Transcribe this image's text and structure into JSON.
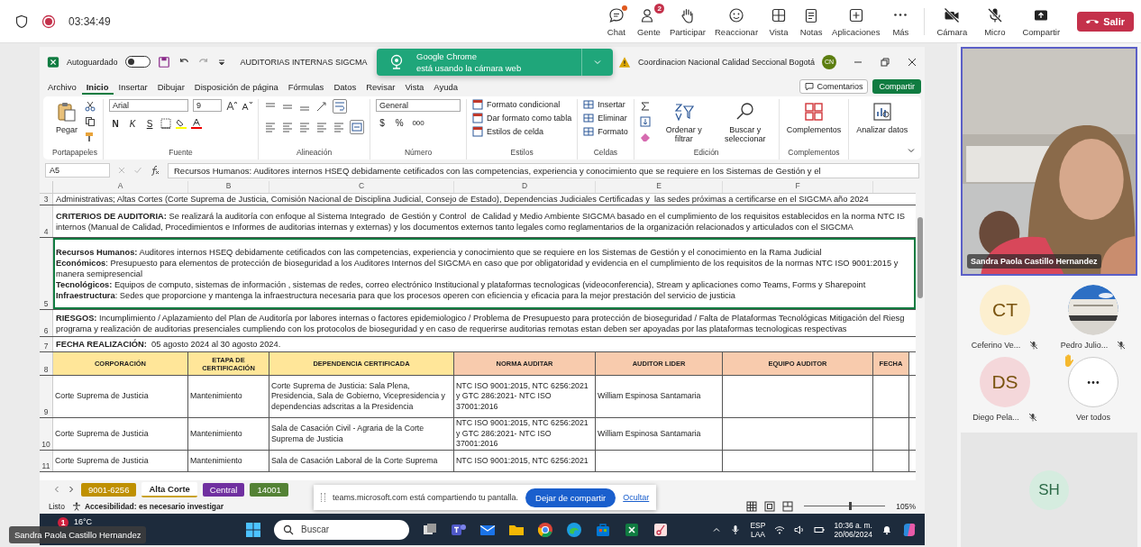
{
  "meeting_bar": {
    "timer": "03:34:49",
    "recording": true,
    "controls": [
      {
        "label": "Chat",
        "unread": true
      },
      {
        "label": "Gente",
        "unread": false,
        "badge": "2"
      },
      {
        "label": "Participar",
        "unread": false
      },
      {
        "label": "Reaccionar",
        "unread": false
      },
      {
        "label": "Vista",
        "unread": false
      },
      {
        "label": "Notas",
        "unread": false
      },
      {
        "label": "Aplicaciones",
        "unread": false
      },
      {
        "label": "Más",
        "unread": false
      }
    ],
    "media": [
      {
        "label": "Cámara",
        "on": false
      },
      {
        "label": "Micro",
        "on": false
      }
    ],
    "share": "Compartir",
    "leave": "Salir"
  },
  "excel": {
    "title_bar": {
      "autosave_label": "Autoguardado",
      "autosave_on": false,
      "file_title": "AUDITORIAS INTERNAS SIGCMA",
      "account": "Coordinacion Nacional Calidad Seccional Bogotá",
      "avatar": "CN"
    },
    "notification": {
      "title": "Google Chrome",
      "message": "está usando la cámara web"
    },
    "menu_tabs": [
      {
        "label": "Archivo",
        "selected": false
      },
      {
        "label": "Inicio",
        "selected": true
      },
      {
        "label": "Insertar",
        "selected": false
      },
      {
        "label": "Dibujar",
        "selected": false
      },
      {
        "label": "Disposición de página",
        "selected": false
      },
      {
        "label": "Fórmulas",
        "selected": false
      },
      {
        "label": "Datos",
        "selected": false
      },
      {
        "label": "Revisar",
        "selected": false
      },
      {
        "label": "Vista",
        "selected": false
      },
      {
        "label": "Ayuda",
        "selected": false
      }
    ],
    "comments_button": "Comentarios",
    "share_button": "Compartir",
    "ribbon": {
      "paste": "Pegar",
      "clipboard": "Portapapeles",
      "font_name": "Arial",
      "font_size": "9",
      "bold": "N",
      "italic": "K",
      "underline": "S",
      "font": "Fuente",
      "alignment": "Alineación",
      "number_format": "General",
      "currency": "$",
      "percent": "%",
      "thousands": "000",
      "number": "Número",
      "style_items": [
        "Formato condicional",
        "Dar formato como tabla",
        "Estilos de celda"
      ],
      "styles": "Estilos",
      "cell_items": [
        "Insertar",
        "Eliminar",
        "Formato"
      ],
      "cells": "Celdas",
      "sort": "Ordenar y filtrar",
      "find": "Buscar y seleccionar",
      "editing": "Edición",
      "addins_button": "Complementos",
      "addins": "Complementos",
      "analyze": "Analizar datos"
    },
    "name_box": "A5",
    "formula": "Recursos Humanos: Auditores internos HSEQ debidamente cetificados con las competencias, experiencia y conocimiento que se requiere en los Sistemas de Gestión y el",
    "column_headers": [
      "A",
      "B",
      "C",
      "D",
      "E",
      "F"
    ],
    "text_rows": [
      {
        "row": "3",
        "selected": false,
        "lines": [
          "Administrativas; Altas Cortes (Corte Suprema de Justicia, Comisión Nacional de Disciplina Judicial, Consejo de Estado), Dependencias Judiciales Certificadas y  las sedes próximas a certificarse en el SIGCMA año 2024"
        ]
      },
      {
        "row": "4",
        "selected": false,
        "lines": [
          "**CRITERIOS DE AUDITORIA:** Se realizará la auditoría con enfoque al Sistema Integrado  de Gestión y Control  de Calidad y Medio Ambiente SIGCMA basado en el cumplimiento de los requisitos establecidos en la norma NTC IS",
          "internos (Manual de Calidad, Procedimientos e Informes de auditorias internas y externas) y los documentos externos tanto legales como reglamentarios de la organización relacionados y articulados con el SIGCMA"
        ]
      },
      {
        "row": "5",
        "selected": true,
        "lines": [
          "**Recursos Humanos:** Auditores internos HSEQ debidamente cetificados con las competencias, experiencia y conocimiento que se requiere en los Sistemas de Gestión y el conocimiento en la Rama Judicial",
          "**Económicos**: Presupuesto para elementos de protección de bioseguridad a los Auditores Internos del SIGCMA en caso que por obligatoridad y evidencia en el cumplimiento de los requisitos de la normas NTC ISO 9001:2015 y",
          "manera semipresencial",
          "**Tecnológicos:** Equipos de computo, sistemas de información , sistemas de redes, correo electrónico Institucional y plataformas tecnologicas (videoconferencia), Stream y aplicaciones como Teams, Forms y Sharepoint",
          "**Infraestructura**: Sedes que proporcione y mantenga la infraestructura necesaria para que los procesos operen con eficiencia y eficacia para la mejor prestación del servicio de justicia"
        ]
      },
      {
        "row": "6",
        "selected": false,
        "lines": [
          "**RIESGOS:** Incumplimiento / Aplazamiento del Plan de Auditoría por labores internas o factores epidemiologico / Problema de Presupuesto para protección de bioseguridad / Falta de Plataformas Tecnológicas Mitigación del Riesg",
          "programa y realización de auditorias presenciales cumpliendo con los protocolos de bioseguridad y en caso de requerirse auditorias remotas estan deben ser apoyadas por las plataformas tecnologicas respectivas"
        ]
      },
      {
        "row": "7",
        "selected": false,
        "lines": [
          "**FECHA REALIZACIÓN:**  05 agosto 2024 al 30 agosto 2024."
        ]
      }
    ],
    "table": {
      "header_row": "8",
      "columns": [
        {
          "label": "CORPORACIÓN",
          "color": "#ffe699"
        },
        {
          "label": "ETAPA DE CERTIFICACIÓN",
          "color": "#ffe699"
        },
        {
          "label": "DEPENDENCIA CERTIFICADA",
          "color": "#ffe699"
        },
        {
          "label": "NORMA AUDITAR",
          "color": "#f8cbad"
        },
        {
          "label": "AUDITOR LIDER",
          "color": "#f8cbad"
        },
        {
          "label": "EQUIPO AUDITOR",
          "color": "#f8cbad"
        },
        {
          "label": "FECHA",
          "color": "#f8cbad"
        }
      ],
      "rows": [
        {
          "row": "9",
          "corporacion": "Corte Suprema de Justicia",
          "etapa": "Mantenimiento",
          "dependencia": "Corte Suprema de Justicia: Sala Plena, Presidencia, Sala de Gobierno, Vicepresidencia y  dependencias adscritas a la Presidencia",
          "norma": "NTC ISO 9001:2015, NTC 6256:2021 y GTC 286:2021- NTC ISO 37001:2016",
          "auditor": "William Espinosa Santamaria"
        },
        {
          "row": "10",
          "corporacion": "Corte Suprema de Justicia",
          "etapa": "Mantenimiento",
          "dependencia": "Sala de Casación Civil - Agraria de la Corte Suprema de Justicia",
          "norma": "NTC ISO 9001:2015, NTC 6256:2021 y GTC 286:2021- NTC ISO 37001:2016",
          "auditor": "William Espinosa Santamaria"
        },
        {
          "row": "11",
          "corporacion": "Corte Suprema de Justicia",
          "etapa": "Mantenimiento",
          "dependencia": "Sala de Casación Laboral  de la Corte Suprema",
          "norma": "NTC ISO 9001:2015, NTC 6256:2021"
        }
      ]
    },
    "sheet_tabs": [
      {
        "label": "9001-6256",
        "color": "#bf9000",
        "selected": false
      },
      {
        "label": "Alta Corte",
        "color": "#c9a227",
        "selected": true
      },
      {
        "label": "Central",
        "color": "#7030a0",
        "selected": false
      },
      {
        "label": "14001",
        "color": "#548235",
        "selected": false
      }
    ],
    "status_bar": {
      "ready": "Listo",
      "accessibility": "Accesibilidad: es necesario investigar",
      "zoom": "105%",
      "zoom_slider": {
        "level": 0.55
      }
    },
    "sharing_bar": {
      "message": "teams.microsoft.com está compartiendo tu pantalla.",
      "stop_button": "Dejar de compartir",
      "hide_link": "Ocultar"
    }
  },
  "taskbar": {
    "weather": "16°C",
    "weather_badge": "1",
    "search_placeholder": "Buscar",
    "language": "ESP",
    "layout": "LAA",
    "time": "10:36 a. m.",
    "date": "20/06/2024"
  },
  "presenter_label": "Sandra Paola Castillo Hernandez",
  "participants_panel": {
    "featured": {
      "name": "Sandra Paola Castillo Hernandez",
      "kind": "picture"
    },
    "participants": [
      {
        "kind": "initials",
        "initials": "CT",
        "name": "Ceferino Ve...",
        "color": "#fcefcf",
        "muted": true
      },
      {
        "name": "Pedro Julio...",
        "muted": true
      },
      {
        "kind": "initials",
        "initials": "DS",
        "name": "Diego Pela...",
        "color": "#f4d7da",
        "muted": true
      }
    ],
    "more": {
      "label": "Ver todos",
      "hand_raised": true
    },
    "self": {
      "initials": "SH",
      "color": "#d5ecdf"
    }
  }
}
